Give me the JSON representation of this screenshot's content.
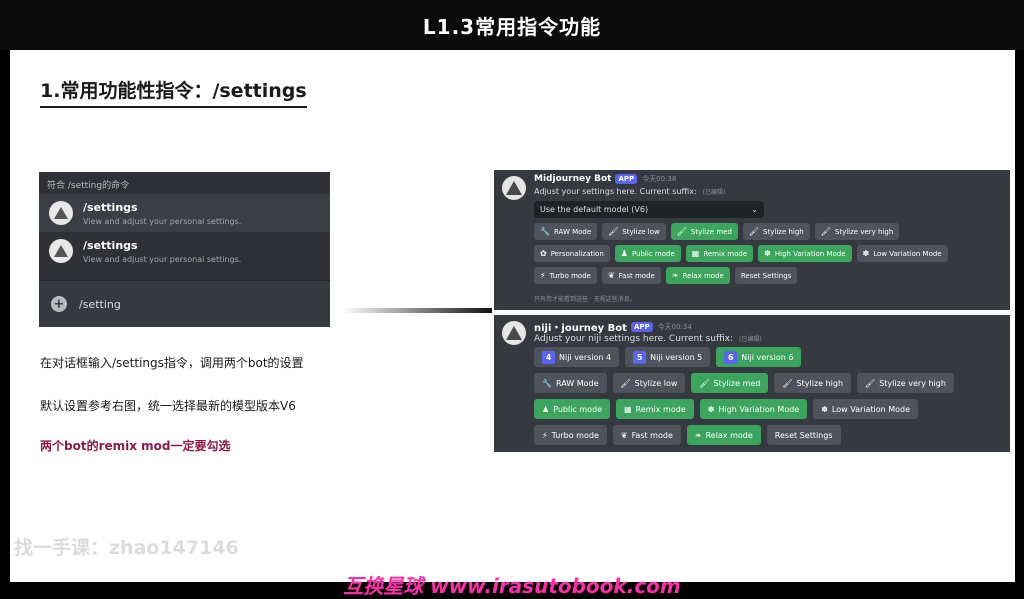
{
  "slide_title": "L1.3常用指令功能",
  "section_heading": "1.常用功能性指令：/settings",
  "command_panel": {
    "header": "符合 /setting的命令",
    "items": [
      {
        "name": "/settings",
        "description": "View and adjust your personal settings."
      },
      {
        "name": "/settings",
        "description": "View and adjust your personal settings."
      }
    ],
    "input_text": "/setting"
  },
  "notes": [
    "在对话框输入/settings指令，调用两个bot的设置",
    "默认设置参考右图，统一选择最新的模型版本V6",
    "两个bot的remix mod一定要勾选"
  ],
  "midjourney_panel": {
    "bot_name": "Midjourney Bot",
    "badge": "APP",
    "time": "今天00:38",
    "message": "Adjust your settings here. Current suffix:",
    "edited": "(已编辑)",
    "select_value": "Use the default model (V6)",
    "row1": [
      {
        "label": "RAW Mode",
        "green": false,
        "icon": "wrench-icon",
        "glyph": "🔧"
      },
      {
        "label": "Stylize low",
        "green": false,
        "icon": "brush-icon",
        "glyph": "🖌"
      },
      {
        "label": "Stylize med",
        "green": true,
        "icon": "brush-icon",
        "glyph": "🖌"
      },
      {
        "label": "Stylize high",
        "green": false,
        "icon": "brush-icon",
        "glyph": "🖌"
      },
      {
        "label": "Stylize very high",
        "green": false,
        "icon": "brush-icon",
        "glyph": "🖌"
      }
    ],
    "row2": [
      {
        "label": "Personalization",
        "green": false,
        "icon": "flower-icon",
        "glyph": "✿"
      },
      {
        "label": "Public mode",
        "green": true,
        "icon": "person-icon",
        "glyph": "♟"
      },
      {
        "label": "Remix mode",
        "green": true,
        "icon": "grid-icon",
        "glyph": "▦"
      },
      {
        "label": "High Variation Mode",
        "green": true,
        "icon": "palette-icon",
        "glyph": "✽"
      },
      {
        "label": "Low Variation Mode",
        "green": false,
        "icon": "palette-icon",
        "glyph": "✽"
      }
    ],
    "row3": [
      {
        "label": "Turbo mode",
        "green": false,
        "icon": "lightning-icon",
        "glyph": "⚡"
      },
      {
        "label": "Fast mode",
        "green": false,
        "icon": "rabbit-icon",
        "glyph": "❦"
      },
      {
        "label": "Relax mode",
        "green": true,
        "icon": "leaf-icon",
        "glyph": "❧"
      },
      {
        "label": "Reset Settings",
        "green": false,
        "icon": "",
        "glyph": ""
      }
    ],
    "footer": "只有您才能看到这些 · 无视这些消息。"
  },
  "niji_panel": {
    "bot_name": "niji・journey Bot",
    "badge": "APP",
    "time": "今天00:34",
    "message": "Adjust your niji settings here. Current suffix:",
    "edited": "(已编辑)",
    "versions": [
      {
        "num": "4",
        "label": "Niji version 4",
        "green": false
      },
      {
        "num": "5",
        "label": "Niji version 5",
        "green": false
      },
      {
        "num": "6",
        "label": "Niji version 6",
        "green": true
      }
    ],
    "row1": [
      {
        "label": "RAW Mode",
        "green": false,
        "icon": "wrench-icon",
        "glyph": "🔧"
      },
      {
        "label": "Stylize low",
        "green": false,
        "icon": "brush-icon",
        "glyph": "🖌"
      },
      {
        "label": "Stylize med",
        "green": true,
        "icon": "brush-icon",
        "glyph": "🖌"
      },
      {
        "label": "Stylize high",
        "green": false,
        "icon": "brush-icon",
        "glyph": "🖌"
      },
      {
        "label": "Stylize very high",
        "green": false,
        "icon": "brush-icon",
        "glyph": "🖌"
      }
    ],
    "row2": [
      {
        "label": "Public mode",
        "green": true,
        "icon": "person-icon",
        "glyph": "♟"
      },
      {
        "label": "Remix mode",
        "green": true,
        "icon": "grid-icon",
        "glyph": "▦"
      },
      {
        "label": "High Variation Mode",
        "green": true,
        "icon": "palette-icon",
        "glyph": "✽"
      },
      {
        "label": "Low Variation Mode",
        "green": false,
        "icon": "palette-icon",
        "glyph": "✽"
      }
    ],
    "row3": [
      {
        "label": "Turbo mode",
        "green": false,
        "icon": "lightning-icon",
        "glyph": "⚡"
      },
      {
        "label": "Fast mode",
        "green": false,
        "icon": "rabbit-icon",
        "glyph": "❦"
      },
      {
        "label": "Relax mode",
        "green": true,
        "icon": "leaf-icon",
        "glyph": "❧"
      },
      {
        "label": "Reset Settings",
        "green": false,
        "icon": "",
        "glyph": ""
      }
    ]
  },
  "watermark_gray": "找一手课：zhao147146",
  "watermark_pink": "互换星球 www.irasutobook.com",
  "colors": {
    "discord_bg": "#36393f",
    "green_button": "#3ba55d",
    "gray_button": "#4f545c",
    "accent": "#5865f2",
    "pink_watermark": "#ff2ea8"
  }
}
